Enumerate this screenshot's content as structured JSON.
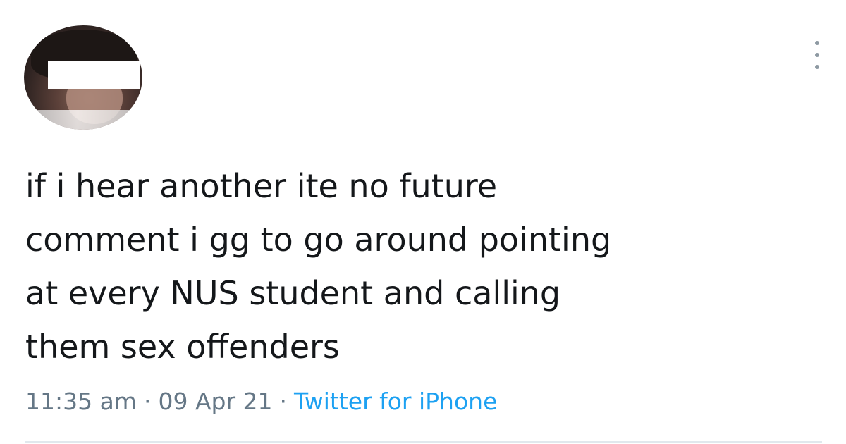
{
  "tweet": {
    "text_lines": [
      "if i hear another ite no future",
      "comment i gg to go around pointing",
      "at every NUS student and calling",
      "them sex offenders"
    ],
    "time": "11:35 am",
    "date": "09 Apr 21",
    "source": "Twitter for iPhone",
    "separator": "·"
  },
  "icons": {
    "more": "more-vertical-icon"
  },
  "colors": {
    "text": "#14171a",
    "meta": "#657786",
    "link": "#1da1f2",
    "divider": "#e1e8ed"
  }
}
